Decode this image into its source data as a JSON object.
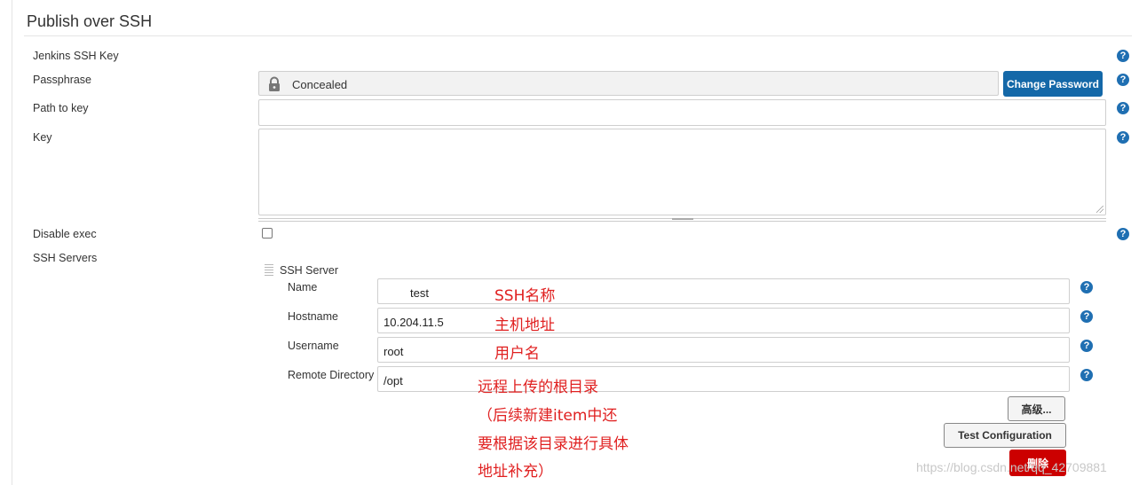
{
  "section": {
    "title": "Publish over SSH"
  },
  "fields": {
    "jenkins_ssh_key_label": "Jenkins SSH Key",
    "passphrase_label": "Passphrase",
    "passphrase_value": "Concealed",
    "change_password_label": "Change Password",
    "path_to_key_label": "Path to key",
    "path_to_key_value": "",
    "key_label": "Key",
    "key_value": "",
    "disable_exec_label": "Disable exec",
    "ssh_servers_label": "SSH Servers"
  },
  "ssh_server": {
    "header": "SSH Server",
    "name_label": "Name",
    "name_value": "test",
    "hostname_label": "Hostname",
    "hostname_value": "10.204.11.5",
    "username_label": "Username",
    "username_value": "root",
    "remote_dir_label": "Remote Directory",
    "remote_dir_value": "/opt",
    "advanced_label": "高级...",
    "test_config_label": "Test Configuration",
    "delete_label": "删除"
  },
  "annotations": {
    "name_note": "SSH名称",
    "hostname_note": "主机地址",
    "username_note": "用户名",
    "remote_note_1": "远程上传的根目录",
    "remote_note_2": "（后续新建item中还",
    "remote_note_3": "要根据该目录进行具体",
    "remote_note_4": "地址补充）"
  },
  "watermark": "https://blog.csdn.net/qq_42709881",
  "colors": {
    "primary_button": "#1468a8",
    "help_icon": "#1f6fb2",
    "delete_button": "#cc0000",
    "annotation_text": "#e02020"
  },
  "icons": [
    "help-icon",
    "lock-icon",
    "drag-handle-icon",
    "resize-grip-icon"
  ]
}
